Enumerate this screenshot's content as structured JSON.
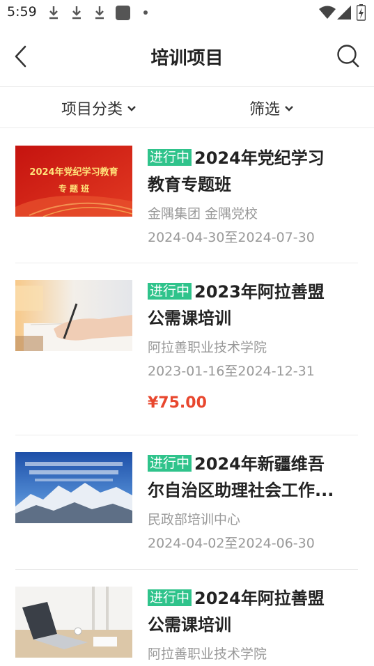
{
  "status_bar": {
    "time": "5:59"
  },
  "header": {
    "title": "培训项目"
  },
  "filters": {
    "category": "项目分类",
    "filter": "筛选"
  },
  "items": [
    {
      "badge": "进行中",
      "title_line1": "2024年党纪学习",
      "title_line2": "教育专题班",
      "org": "金隅集团 金隅党校",
      "date": "2024-04-30至2024-07-30",
      "price": "",
      "thumb_text1": "2024年党纪学习教育",
      "thumb_text2": "专 题 班"
    },
    {
      "badge": "进行中",
      "title_line1": "2023年阿拉善盟",
      "title_line2": "公需课培训",
      "org": "阿拉善职业技术学院",
      "date": "2023-01-16至2024-12-31",
      "price": "¥75.00"
    },
    {
      "badge": "进行中",
      "title_line1": "2024年新疆维吾",
      "title_line2": "尔自治区助理社会工作...",
      "org": "民政部培训中心",
      "date": "2024-04-02至2024-06-30",
      "price": ""
    },
    {
      "badge": "进行中",
      "title_line1": "2024年阿拉善盟",
      "title_line2": "公需课培训",
      "org": "阿拉善职业技术学院",
      "date": "",
      "price": ""
    }
  ],
  "colors": {
    "badge": "#2fc38b",
    "price": "#e8472e",
    "thumb1_bg": "#d8201c"
  }
}
